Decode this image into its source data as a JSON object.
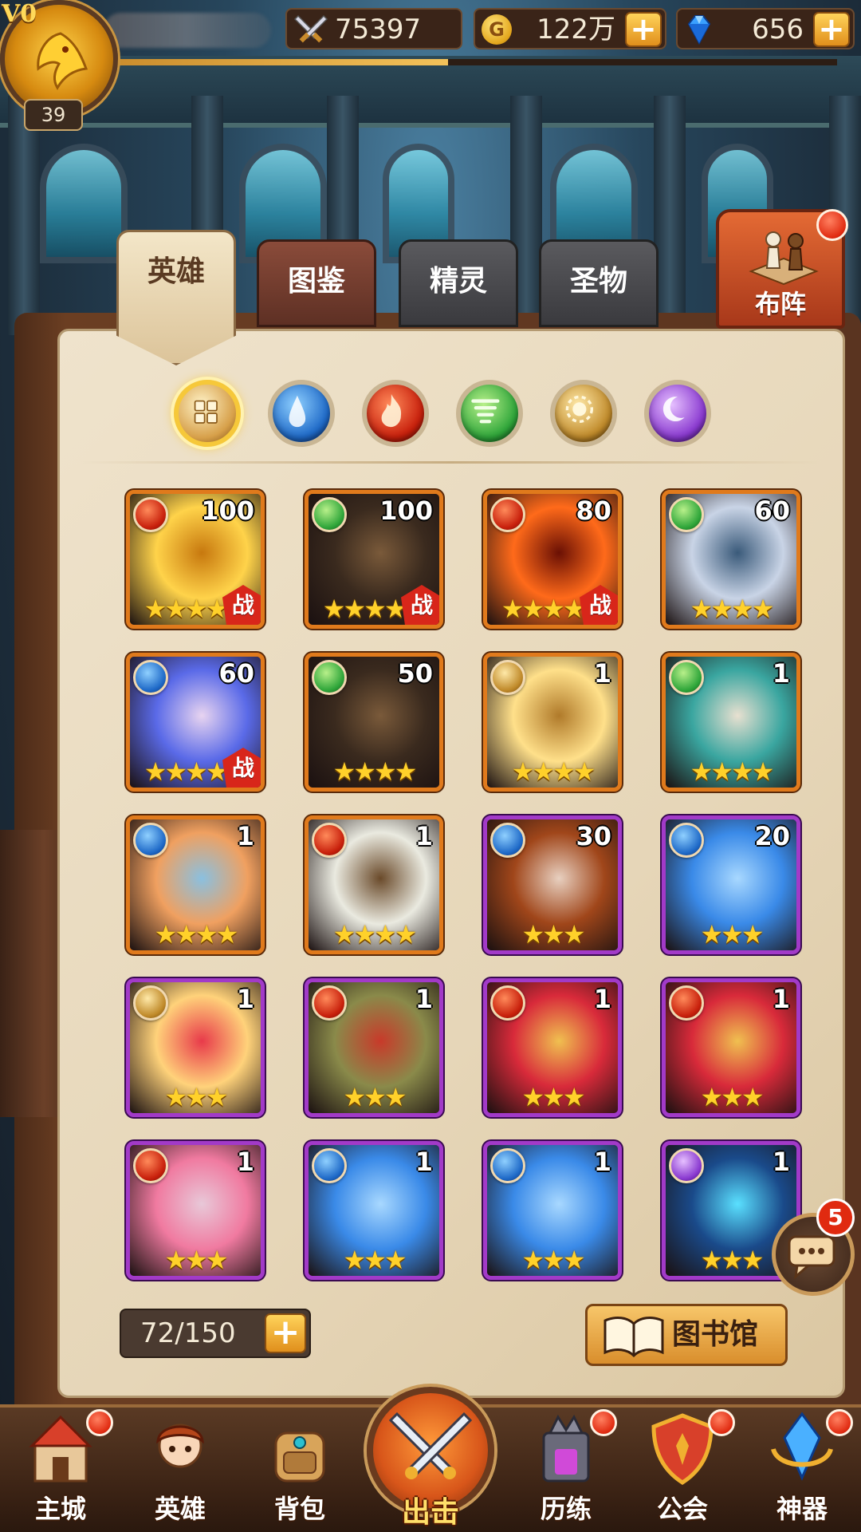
{
  "player": {
    "vip": "V0",
    "level": "39",
    "xp_fraction": 0.47
  },
  "resources": {
    "power": "75397",
    "gold": "122万",
    "gems": "656",
    "gold_icon_glyph": "G"
  },
  "tabs": [
    {
      "label": "英雄",
      "active": true
    },
    {
      "label": "图鉴",
      "active": false
    },
    {
      "label": "精灵",
      "active": false
    },
    {
      "label": "圣物",
      "active": false
    }
  ],
  "formation": {
    "label": "布阵"
  },
  "filters": [
    "all",
    "water",
    "fire",
    "wind",
    "light",
    "dark"
  ],
  "heroes": [
    {
      "element": "fire",
      "level": "100",
      "stars": "★★★★★",
      "rarity": "orange",
      "in_battle": true,
      "portrait": "golden-phoenix"
    },
    {
      "element": "wind",
      "level": "100",
      "stars": "★★★★★",
      "rarity": "orange",
      "in_battle": true,
      "portrait": "panda-warrior"
    },
    {
      "element": "fire",
      "level": "80",
      "stars": "★★★★★",
      "rarity": "orange",
      "in_battle": true,
      "portrait": "lava-demon"
    },
    {
      "element": "wind",
      "level": "60",
      "stars": "★★★★",
      "rarity": "orange",
      "in_battle": false,
      "portrait": "silver-hair-knight"
    },
    {
      "element": "water",
      "level": "60",
      "stars": "★★★★★",
      "rarity": "orange",
      "in_battle": true,
      "portrait": "blue-hair-mage"
    },
    {
      "element": "wind",
      "level": "50",
      "stars": "★★★★",
      "rarity": "orange",
      "in_battle": false,
      "portrait": "panda-warrior"
    },
    {
      "element": "light",
      "level": "1",
      "stars": "★★★★",
      "rarity": "orange",
      "in_battle": false,
      "portrait": "golden-valkyrie"
    },
    {
      "element": "wind",
      "level": "1",
      "stars": "★★★★",
      "rarity": "orange",
      "in_battle": false,
      "portrait": "jade-empress"
    },
    {
      "element": "water",
      "level": "1",
      "stars": "★★★★",
      "rarity": "orange",
      "in_battle": false,
      "portrait": "hooded-priestess"
    },
    {
      "element": "fire",
      "level": "1",
      "stars": "★★★★",
      "rarity": "orange",
      "in_battle": false,
      "portrait": "white-hair-sage"
    },
    {
      "element": "water",
      "level": "30",
      "stars": "★★★",
      "rarity": "purple",
      "in_battle": false,
      "portrait": "brown-hair-swordsman"
    },
    {
      "element": "water",
      "level": "20",
      "stars": "★★★",
      "rarity": "purple",
      "in_battle": false,
      "portrait": "blue-elf"
    },
    {
      "element": "light",
      "level": "1",
      "stars": "★★★",
      "rarity": "purple",
      "in_battle": false,
      "portrait": "cupid-girl"
    },
    {
      "element": "fire",
      "level": "1",
      "stars": "★★★",
      "rarity": "purple",
      "in_battle": false,
      "portrait": "war-painted-brawler"
    },
    {
      "element": "fire",
      "level": "1",
      "stars": "★★★",
      "rarity": "purple",
      "in_battle": false,
      "portrait": "crimson-elf"
    },
    {
      "element": "fire",
      "level": "1",
      "stars": "★★★",
      "rarity": "purple",
      "in_battle": false,
      "portrait": "crimson-elf"
    },
    {
      "element": "fire",
      "level": "1",
      "stars": "★★★",
      "rarity": "purple",
      "in_battle": false,
      "portrait": "pink-hair-girl"
    },
    {
      "element": "water",
      "level": "1",
      "stars": "★★★",
      "rarity": "purple",
      "in_battle": false,
      "portrait": "blue-elf"
    },
    {
      "element": "water",
      "level": "1",
      "stars": "★★★",
      "rarity": "purple",
      "in_battle": false,
      "portrait": "blue-elf"
    },
    {
      "element": "dark",
      "level": "1",
      "stars": "★★★",
      "rarity": "purple",
      "in_battle": false,
      "portrait": "lightning-dragon"
    }
  ],
  "battle_badge": "战",
  "capacity": "72/150",
  "library": {
    "label": "图书馆"
  },
  "chat": {
    "unread": "5"
  },
  "nav": [
    {
      "label": "主城",
      "icon": "castle-icon",
      "dot": true
    },
    {
      "label": "英雄",
      "icon": "hero-icon",
      "dot": false
    },
    {
      "label": "背包",
      "icon": "backpack-icon",
      "dot": false
    },
    {
      "label": "出击",
      "icon": "crossed-swords-icon",
      "dot": false
    },
    {
      "label": "历练",
      "icon": "trial-tower-icon",
      "dot": true
    },
    {
      "label": "公会",
      "icon": "guild-shield-icon",
      "dot": true
    },
    {
      "label": "神器",
      "icon": "artifact-crystal-icon",
      "dot": true
    }
  ]
}
